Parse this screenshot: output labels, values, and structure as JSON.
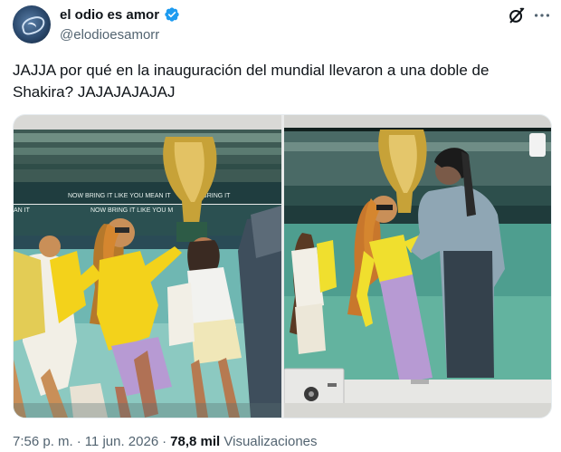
{
  "author": {
    "display_name": "el odio es amor",
    "handle": "@elodioesamorr",
    "verified": true,
    "avatar_icon": "avatar-logo"
  },
  "header_actions": {
    "grok_icon": "grok-icon",
    "more_icon": "more-options-icon"
  },
  "tweet": {
    "text": "JAJJA por qué en la inauguración del mundial llevaron a una doble de\nShakira? JAJAJAJAJAJ"
  },
  "media": {
    "photo_count": 2,
    "left_photo_banners": [
      "NOW BRING IT LIKE YOU MEAN IT"
    ],
    "right_photo_logo": "tv-logo"
  },
  "meta": {
    "time": "7:56 p. m.",
    "separator": "·",
    "date": "11 jun. 2026",
    "views_count": "78,8 mil",
    "views_label": "Visualizaciones"
  },
  "colors": {
    "verified_blue": "#1d9bf0",
    "secondary_text": "#536471",
    "primary_text": "#0f1419"
  }
}
